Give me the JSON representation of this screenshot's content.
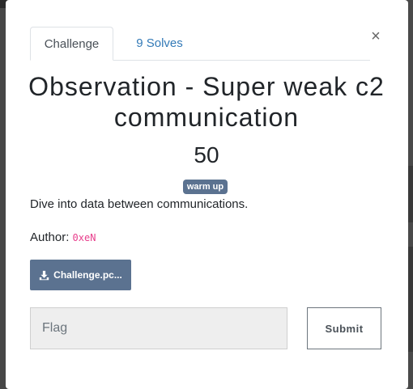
{
  "modal": {
    "close_glyph": "×",
    "tabs": [
      {
        "label": "Challenge"
      },
      {
        "label": "9 Solves"
      }
    ],
    "title": "Observation - Super weak c2 communication",
    "points": "50",
    "tag": "warm up",
    "description": "Dive into data between communications.",
    "author_label": "Author: ",
    "author_name": "0xeN",
    "file_button_label": "Challenge.pc...",
    "flag_placeholder": "Flag",
    "submit_label": "Submit"
  },
  "colors": {
    "accent": "#5b7290",
    "link": "#337ab7",
    "code": "#e83e8c"
  },
  "icons": {
    "close": "close-icon",
    "download": "download-icon"
  }
}
